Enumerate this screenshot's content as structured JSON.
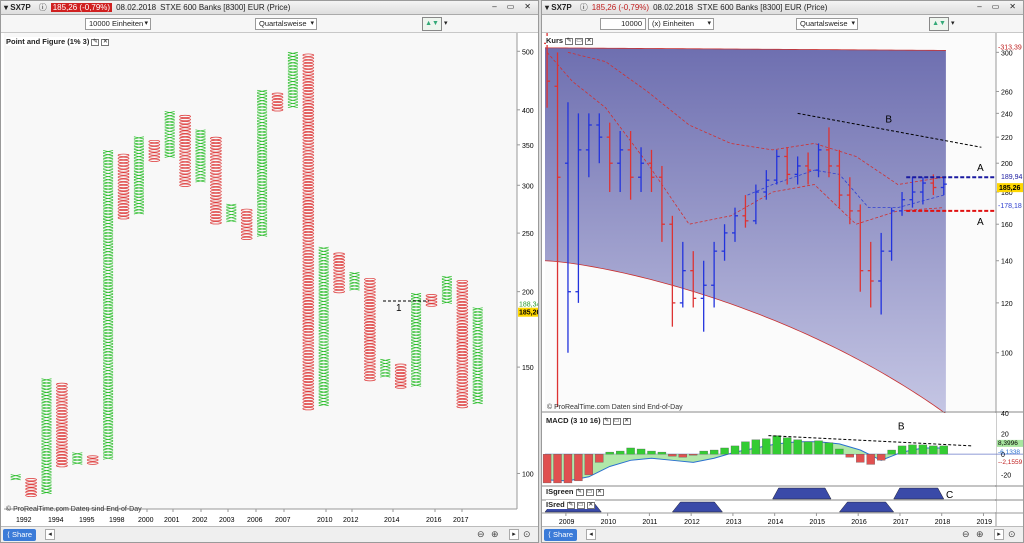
{
  "left": {
    "title": {
      "symbol": "SX7P",
      "price": "185,26 (-0,79%)",
      "date": "08.02.2018",
      "name": "STXE 600 Banks [8300] EUR (Price)"
    },
    "units_select": "10000 Einheiten",
    "period_select": "Quartalsweise",
    "panel_label": "Point and Figure (1% 3)",
    "watermark": "© ProRealTime.com  Daten sind End-of-Day",
    "share": "Share",
    "annotation": "1"
  },
  "right": {
    "title": {
      "symbol": "SX7P",
      "price": "185,26 (-0,79%)",
      "date": "08.02.2018",
      "name": "STXE 600 Banks [8300] EUR (Price)"
    },
    "units_value": "10000",
    "units_select": "(x) Einheiten",
    "period_select": "Quartalsweise",
    "panels": {
      "price": "Kurs",
      "macd": "MACD (3 10 16)",
      "isgreen": "ISgreen",
      "isred": "ISred"
    },
    "watermark": "© ProRealTime.com  Daten sind End-of-Day",
    "share": "Share",
    "annotations": {
      "b_price": "B",
      "a_top": "A",
      "a_bottom": "A",
      "b_macd": "B",
      "c_isgreen": "C"
    }
  },
  "colors": {
    "up": "#22bb22",
    "down": "#dd3333",
    "bar_blue": "#2233dd",
    "cloud": "#7e7fba",
    "price_tag": "#ffd700"
  },
  "chart_data": [
    {
      "type": "point-and-figure",
      "box_size": "1%",
      "reversal": 3,
      "yscale": "log",
      "ylim": [
        88,
        520
      ],
      "yticks": [
        100,
        150,
        200,
        250,
        300,
        350,
        400,
        500
      ],
      "x_labels": [
        "1992",
        "1994",
        "1995",
        "1998",
        "2000",
        "2001",
        "2002",
        "2003",
        "2006",
        "2007",
        "2010",
        "2012",
        "2014",
        "2016",
        "2017"
      ],
      "price_labels": [
        "188,34",
        "185,26"
      ],
      "columns": [
        {
          "type": "X",
          "low": 98,
          "high": 100
        },
        {
          "type": "O",
          "low": 92,
          "high": 98
        },
        {
          "type": "X",
          "low": 93,
          "high": 143
        },
        {
          "type": "O",
          "low": 103,
          "high": 141
        },
        {
          "type": "X",
          "low": 104,
          "high": 108
        },
        {
          "type": "O",
          "low": 104,
          "high": 107
        },
        {
          "type": "X",
          "low": 106,
          "high": 345
        },
        {
          "type": "O",
          "low": 265,
          "high": 340
        },
        {
          "type": "X",
          "low": 270,
          "high": 360
        },
        {
          "type": "O",
          "low": 330,
          "high": 355
        },
        {
          "type": "X",
          "low": 335,
          "high": 400
        },
        {
          "type": "O",
          "low": 300,
          "high": 390
        },
        {
          "type": "X",
          "low": 305,
          "high": 370
        },
        {
          "type": "O",
          "low": 260,
          "high": 360
        },
        {
          "type": "X",
          "low": 262,
          "high": 280
        },
        {
          "type": "O",
          "low": 245,
          "high": 275
        },
        {
          "type": "X",
          "low": 248,
          "high": 430
        },
        {
          "type": "O",
          "low": 400,
          "high": 425
        },
        {
          "type": "X",
          "low": 405,
          "high": 500
        },
        {
          "type": "O",
          "low": 128,
          "high": 495
        },
        {
          "type": "X",
          "low": 130,
          "high": 237
        },
        {
          "type": "O",
          "low": 200,
          "high": 233
        },
        {
          "type": "X",
          "low": 202,
          "high": 215
        },
        {
          "type": "O",
          "low": 143,
          "high": 211
        },
        {
          "type": "X",
          "low": 145,
          "high": 155
        },
        {
          "type": "O",
          "low": 139,
          "high": 152
        },
        {
          "type": "X",
          "low": 140,
          "high": 199
        },
        {
          "type": "O",
          "low": 190,
          "high": 197
        },
        {
          "type": "X",
          "low": 192,
          "high": 212
        },
        {
          "type": "O",
          "low": 129,
          "high": 208
        },
        {
          "type": "X",
          "low": 131,
          "high": 189
        }
      ]
    },
    {
      "type": "ohlc",
      "yscale": "log",
      "ylim": [
        82,
        315
      ],
      "yticks": [
        100,
        120,
        140,
        160,
        180,
        200,
        220,
        240,
        260,
        300
      ],
      "x_labels": [
        "2009",
        "2010",
        "2011",
        "2012",
        "2013",
        "2014",
        "2015",
        "2016",
        "2017",
        "2018",
        "2019"
      ],
      "x_range": [
        2008.55,
        2019.35
      ],
      "price_labels": {
        "upper_band": "313,39",
        "dashed_top": "189,94",
        "last": "185,26",
        "ma": "178,18"
      },
      "bars": [
        {
          "t": 2008.6,
          "o": 310,
          "h": 325,
          "l": 245,
          "c": 270,
          "color": "red"
        },
        {
          "t": 2008.85,
          "o": 265,
          "h": 300,
          "l": 82,
          "c": 190,
          "color": "red"
        },
        {
          "t": 2009.1,
          "o": 200,
          "h": 250,
          "l": 100,
          "c": 125,
          "color": "blue"
        },
        {
          "t": 2009.35,
          "o": 125,
          "h": 240,
          "l": 120,
          "c": 210,
          "color": "blue"
        },
        {
          "t": 2009.6,
          "o": 210,
          "h": 240,
          "l": 190,
          "c": 230,
          "color": "blue"
        },
        {
          "t": 2009.85,
          "o": 230,
          "h": 240,
          "l": 200,
          "c": 220,
          "color": "blue"
        },
        {
          "t": 2010.1,
          "o": 220,
          "h": 232,
          "l": 180,
          "c": 200,
          "color": "red"
        },
        {
          "t": 2010.35,
          "o": 200,
          "h": 225,
          "l": 180,
          "c": 210,
          "color": "blue"
        },
        {
          "t": 2010.6,
          "o": 210,
          "h": 225,
          "l": 175,
          "c": 190,
          "color": "red"
        },
        {
          "t": 2010.85,
          "o": 190,
          "h": 212,
          "l": 180,
          "c": 200,
          "color": "blue"
        },
        {
          "t": 2011.1,
          "o": 200,
          "h": 210,
          "l": 180,
          "c": 190,
          "color": "red"
        },
        {
          "t": 2011.35,
          "o": 190,
          "h": 198,
          "l": 150,
          "c": 160,
          "color": "red"
        },
        {
          "t": 2011.6,
          "o": 160,
          "h": 165,
          "l": 110,
          "c": 120,
          "color": "red"
        },
        {
          "t": 2011.85,
          "o": 120,
          "h": 150,
          "l": 118,
          "c": 135,
          "color": "blue"
        },
        {
          "t": 2012.1,
          "o": 135,
          "h": 145,
          "l": 118,
          "c": 122,
          "color": "red"
        },
        {
          "t": 2012.35,
          "o": 122,
          "h": 140,
          "l": 108,
          "c": 128,
          "color": "blue"
        },
        {
          "t": 2012.6,
          "o": 128,
          "h": 150,
          "l": 118,
          "c": 145,
          "color": "blue"
        },
        {
          "t": 2012.85,
          "o": 145,
          "h": 160,
          "l": 140,
          "c": 155,
          "color": "blue"
        },
        {
          "t": 2013.1,
          "o": 155,
          "h": 170,
          "l": 150,
          "c": 165,
          "color": "blue"
        },
        {
          "t": 2013.35,
          "o": 165,
          "h": 178,
          "l": 158,
          "c": 162,
          "color": "red"
        },
        {
          "t": 2013.6,
          "o": 162,
          "h": 185,
          "l": 160,
          "c": 180,
          "color": "blue"
        },
        {
          "t": 2013.85,
          "o": 180,
          "h": 195,
          "l": 175,
          "c": 188,
          "color": "blue"
        },
        {
          "t": 2014.1,
          "o": 188,
          "h": 210,
          "l": 185,
          "c": 205,
          "color": "blue"
        },
        {
          "t": 2014.35,
          "o": 205,
          "h": 212,
          "l": 185,
          "c": 192,
          "color": "red"
        },
        {
          "t": 2014.6,
          "o": 192,
          "h": 205,
          "l": 185,
          "c": 198,
          "color": "blue"
        },
        {
          "t": 2014.85,
          "o": 198,
          "h": 208,
          "l": 185,
          "c": 195,
          "color": "red"
        },
        {
          "t": 2015.1,
          "o": 195,
          "h": 215,
          "l": 190,
          "c": 210,
          "color": "blue"
        },
        {
          "t": 2015.35,
          "o": 210,
          "h": 228,
          "l": 190,
          "c": 198,
          "color": "red"
        },
        {
          "t": 2015.6,
          "o": 198,
          "h": 210,
          "l": 170,
          "c": 178,
          "color": "red"
        },
        {
          "t": 2015.85,
          "o": 178,
          "h": 190,
          "l": 160,
          "c": 168,
          "color": "red"
        },
        {
          "t": 2016.1,
          "o": 168,
          "h": 172,
          "l": 125,
          "c": 135,
          "color": "red"
        },
        {
          "t": 2016.35,
          "o": 135,
          "h": 150,
          "l": 118,
          "c": 130,
          "color": "red"
        },
        {
          "t": 2016.6,
          "o": 130,
          "h": 155,
          "l": 115,
          "c": 145,
          "color": "blue"
        },
        {
          "t": 2016.85,
          "o": 145,
          "h": 170,
          "l": 140,
          "c": 168,
          "color": "blue"
        },
        {
          "t": 2017.1,
          "o": 168,
          "h": 180,
          "l": 165,
          "c": 175,
          "color": "blue"
        },
        {
          "t": 2017.35,
          "o": 175,
          "h": 190,
          "l": 170,
          "c": 180,
          "color": "blue"
        },
        {
          "t": 2017.6,
          "o": 180,
          "h": 190,
          "l": 172,
          "c": 186,
          "color": "blue"
        },
        {
          "t": 2017.85,
          "o": 186,
          "h": 192,
          "l": 178,
          "c": 183,
          "color": "red"
        },
        {
          "t": 2018.1,
          "o": 183,
          "h": 190,
          "l": 178,
          "c": 185.26,
          "color": "blue"
        }
      ],
      "horizontal_lines": [
        {
          "label": "A",
          "y": 190,
          "style": "dashed",
          "color": "#1a1aa0"
        },
        {
          "label": "A",
          "y": 168,
          "style": "dashed",
          "color": "#e01010"
        }
      ],
      "trendlines": [
        {
          "label": "B",
          "from": [
            2014.6,
            240
          ],
          "to": [
            2019.0,
            212
          ]
        }
      ]
    },
    {
      "type": "bar+line",
      "name": "MACD (3 10 16)",
      "ylim": [
        -30,
        40
      ],
      "yticks": [
        40,
        20,
        0,
        -20
      ],
      "value_labels": [
        "8,3996",
        "6,1338",
        "-2,1559"
      ],
      "histogram": [
        {
          "t": 2008.6,
          "v": -28
        },
        {
          "t": 2008.85,
          "v": -28
        },
        {
          "t": 2009.1,
          "v": -28
        },
        {
          "t": 2009.35,
          "v": -26
        },
        {
          "t": 2009.6,
          "v": -20
        },
        {
          "t": 2009.85,
          "v": -8
        },
        {
          "t": 2010.1,
          "v": 2
        },
        {
          "t": 2010.35,
          "v": 3
        },
        {
          "t": 2010.6,
          "v": 6
        },
        {
          "t": 2010.85,
          "v": 5
        },
        {
          "t": 2011.1,
          "v": 3
        },
        {
          "t": 2011.35,
          "v": 2
        },
        {
          "t": 2011.6,
          "v": -2
        },
        {
          "t": 2011.85,
          "v": -3
        },
        {
          "t": 2012.1,
          "v": -1
        },
        {
          "t": 2012.35,
          "v": 3
        },
        {
          "t": 2012.6,
          "v": 4
        },
        {
          "t": 2012.85,
          "v": 6
        },
        {
          "t": 2013.1,
          "v": 8
        },
        {
          "t": 2013.35,
          "v": 12
        },
        {
          "t": 2013.6,
          "v": 14
        },
        {
          "t": 2013.85,
          "v": 15
        },
        {
          "t": 2014.1,
          "v": 18
        },
        {
          "t": 2014.35,
          "v": 16
        },
        {
          "t": 2014.6,
          "v": 14
        },
        {
          "t": 2014.85,
          "v": 12
        },
        {
          "t": 2015.1,
          "v": 13
        },
        {
          "t": 2015.35,
          "v": 11
        },
        {
          "t": 2015.6,
          "v": 5
        },
        {
          "t": 2015.85,
          "v": -3
        },
        {
          "t": 2016.1,
          "v": -8
        },
        {
          "t": 2016.35,
          "v": -10
        },
        {
          "t": 2016.6,
          "v": -6
        },
        {
          "t": 2016.85,
          "v": 4
        },
        {
          "t": 2017.1,
          "v": 8
        },
        {
          "t": 2017.35,
          "v": 9
        },
        {
          "t": 2017.6,
          "v": 9
        },
        {
          "t": 2017.85,
          "v": 8
        },
        {
          "t": 2018.1,
          "v": 8
        }
      ],
      "macd_line": [
        [
          2008.6,
          -25
        ],
        [
          2009.1,
          -26
        ],
        [
          2009.6,
          -22
        ],
        [
          2010.1,
          -12
        ],
        [
          2010.6,
          -6
        ],
        [
          2011.1,
          -4
        ],
        [
          2011.6,
          -6
        ],
        [
          2012.1,
          -8
        ],
        [
          2012.6,
          -4
        ],
        [
          2013.1,
          2
        ],
        [
          2013.6,
          6
        ],
        [
          2014.1,
          10
        ],
        [
          2014.6,
          12
        ],
        [
          2015.1,
          12
        ],
        [
          2015.6,
          10
        ],
        [
          2016.1,
          4
        ],
        [
          2016.6,
          -6
        ],
        [
          2017.1,
          2
        ],
        [
          2017.6,
          6
        ],
        [
          2018.1,
          6
        ]
      ],
      "trendlines": [
        {
          "label": "B",
          "from": [
            2013.9,
            18
          ],
          "to": [
            2018.8,
            8
          ]
        }
      ]
    },
    {
      "type": "area",
      "name": "ISgreen",
      "note_label": "C",
      "pulses": [
        [
          2014.0,
          2015.4
        ],
        [
          2016.9,
          2018.1
        ]
      ]
    },
    {
      "type": "area",
      "name": "ISred",
      "pulses": [
        [
          2008.55,
          2009.9
        ],
        [
          2011.6,
          2012.8
        ],
        [
          2015.6,
          2016.9
        ]
      ]
    }
  ]
}
